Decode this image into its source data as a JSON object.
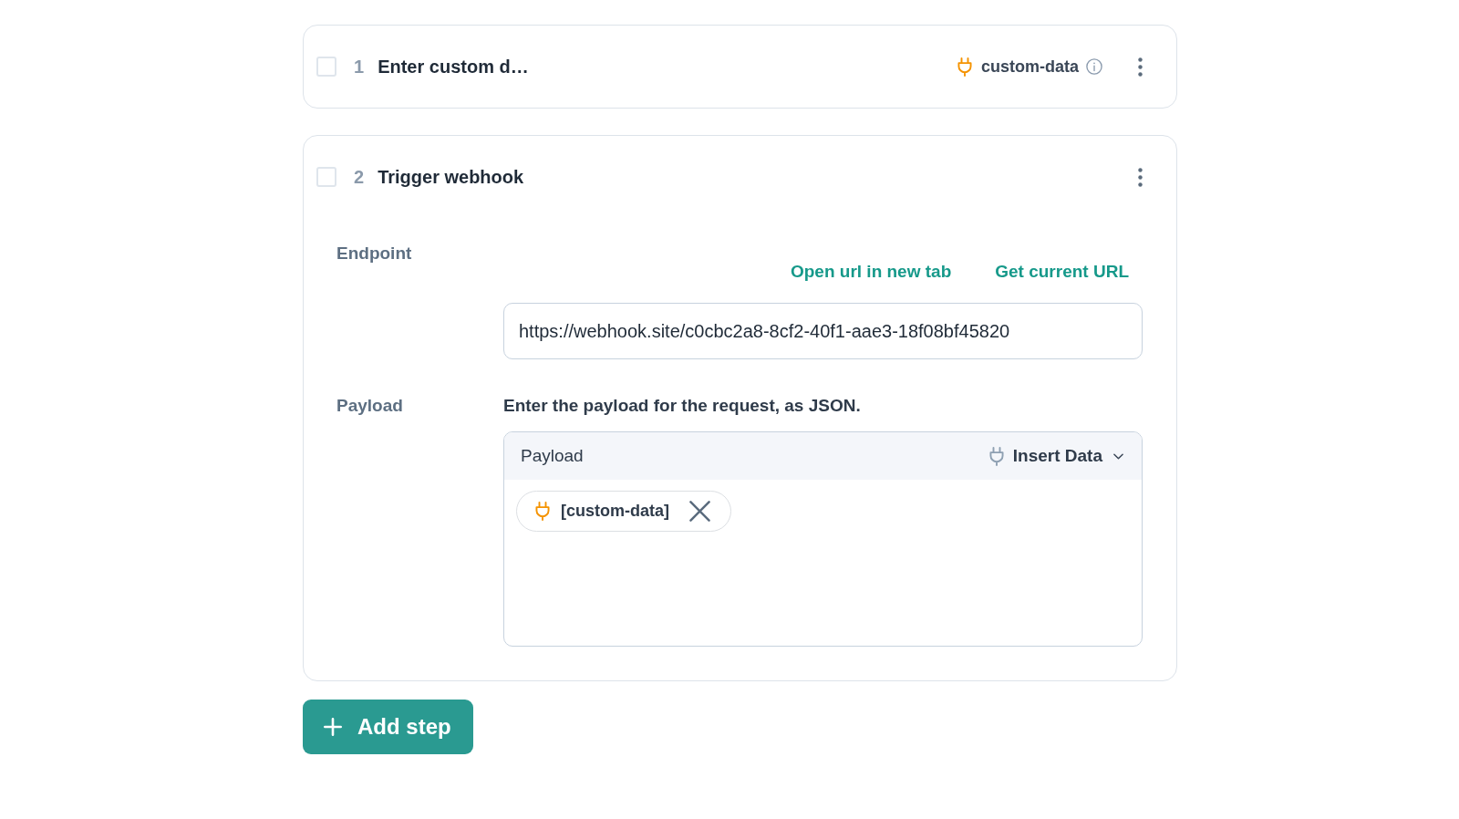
{
  "steps": [
    {
      "number": "1",
      "title": "Enter custom d…",
      "checked": false,
      "output": "custom-data"
    },
    {
      "number": "2",
      "title": "Trigger webhook",
      "checked": false,
      "fields": [
        {
          "kind": "url",
          "label": "Endpoint",
          "links": [
            "Open url in new tab",
            "Get current URL"
          ],
          "value": "https://webhook.site/c0cbc2a8-8cf2-40f1-aae3-18f08bf45820"
        },
        {
          "kind": "payload",
          "label": "Payload",
          "description": "Enter the payload for the request, as JSON.",
          "editor": {
            "title": "Payload",
            "insert_button": "Insert Data",
            "tokens": [
              "[custom-data]"
            ]
          }
        }
      ]
    }
  ],
  "add_button": {
    "label": "Add step"
  }
}
